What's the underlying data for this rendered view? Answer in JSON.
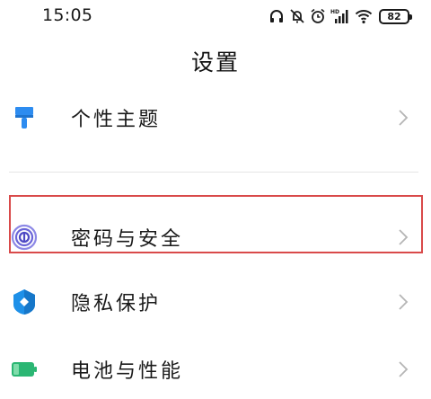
{
  "status_bar": {
    "time": "15:05",
    "battery_level": "82",
    "icons": [
      "headphones-icon",
      "mute-icon",
      "alarm-icon",
      "hd-signal-icon",
      "wifi-icon",
      "battery-icon"
    ]
  },
  "header": {
    "title": "设置"
  },
  "settings": {
    "items": [
      {
        "label": "个性主题",
        "icon": "paint-brush-icon",
        "icon_color": "#2d8cf0"
      },
      {
        "label": "密码与安全",
        "icon": "fingerprint-icon",
        "icon_color": "#6a64d8"
      },
      {
        "label": "隐私保护",
        "icon": "privacy-shield-icon",
        "icon_color": "#1e90e8"
      },
      {
        "label": "电池与性能",
        "icon": "battery-icon",
        "icon_color": "#2bb673"
      }
    ]
  },
  "colors": {
    "highlight_border": "#d94a4a",
    "chevron": "#b5b5b5",
    "divider": "#e6e6e6"
  }
}
